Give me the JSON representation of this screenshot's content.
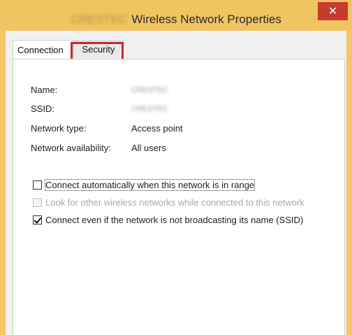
{
  "window": {
    "network_name": "CRESTEC",
    "title": "Wireless Network Properties",
    "close_label": "✕"
  },
  "tabs": [
    {
      "label": "Connection",
      "selected": true
    },
    {
      "label": "Security",
      "selected": false
    }
  ],
  "properties": [
    {
      "label": "Name:",
      "value": "CRESTEC"
    },
    {
      "label": "SSID:",
      "value": "CRESTEC"
    },
    {
      "label": "Network type:",
      "value": "Access point"
    },
    {
      "label": "Network availability:",
      "value": "All users"
    }
  ],
  "options": [
    {
      "label": "Connect automatically when this network is in range",
      "checked": false,
      "enabled": true
    },
    {
      "label": "Look for other wireless networks while connected to this network",
      "checked": false,
      "enabled": false
    },
    {
      "label": "Connect even if the network is not broadcasting its name (SSID)",
      "checked": true,
      "enabled": true
    }
  ],
  "colors": {
    "title_bar": "#f1c462",
    "close_button": "#c8392e",
    "highlight": "#c62a2a"
  }
}
